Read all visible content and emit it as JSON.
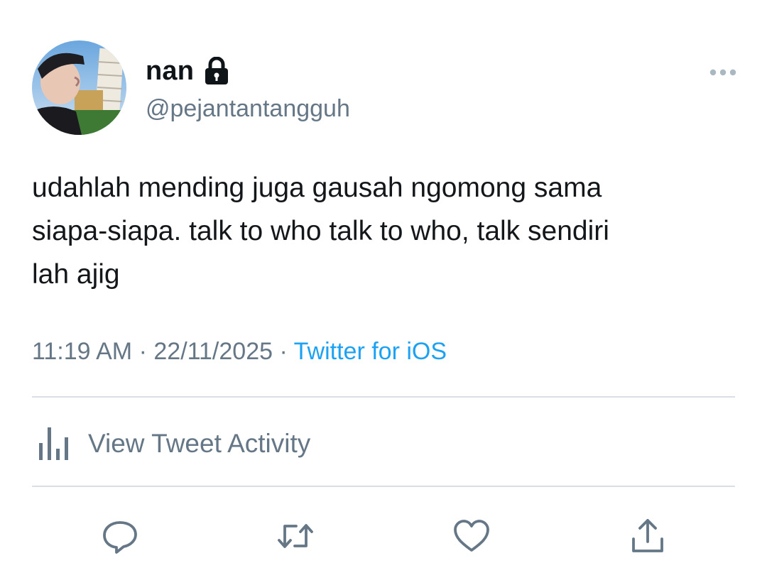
{
  "author": {
    "display_name": "nan",
    "handle": "@pejantantangguh",
    "protected_icon": "lock-icon",
    "avatar_icon": "profile-photo"
  },
  "tweet": {
    "text": "udahlah mending juga gausah ngomong sama\nsiapa-siapa. talk to who talk to who, talk sendiri\nlah ajig",
    "time": "11:19 AM",
    "separator": "·",
    "date": "22/11/2025",
    "source": "Twitter for iOS"
  },
  "activity": {
    "label": "View Tweet Activity",
    "icon": "bar-chart-icon"
  },
  "actions": {
    "reply_icon": "reply-icon",
    "retweet_icon": "retweet-icon",
    "like_icon": "heart-icon",
    "share_icon": "share-icon"
  },
  "colors": {
    "secondary_text": "#657786",
    "link": "#1da1f2",
    "divider": "#d9dfe4",
    "primary_text": "#14171a"
  }
}
